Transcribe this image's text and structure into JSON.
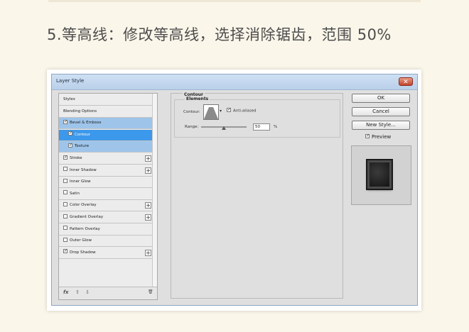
{
  "article": {
    "heading": "5.等高线：修改等高线，选择消除锯齿，范围 50%"
  },
  "dialog": {
    "title": "Layer Style",
    "close_symbol": "✕",
    "left_panel": {
      "items": [
        {
          "label": "Styles",
          "checked": null,
          "plus": false
        },
        {
          "label": "Blending Options",
          "checked": null,
          "plus": false
        },
        {
          "label": "Bevel & Emboss",
          "checked": true,
          "plus": false
        },
        {
          "label": "Contour",
          "checked": true,
          "plus": false
        },
        {
          "label": "Texture",
          "checked": true,
          "plus": false
        },
        {
          "label": "Stroke",
          "checked": true,
          "plus": true
        },
        {
          "label": "Inner Shadow",
          "checked": false,
          "plus": true
        },
        {
          "label": "Inner Glow",
          "checked": false,
          "plus": false
        },
        {
          "label": "Satin",
          "checked": false,
          "plus": false
        },
        {
          "label": "Color Overlay",
          "checked": false,
          "plus": true
        },
        {
          "label": "Gradient Overlay",
          "checked": false,
          "plus": true
        },
        {
          "label": "Pattern Overlay",
          "checked": false,
          "plus": false
        },
        {
          "label": "Outer Glow",
          "checked": false,
          "plus": false
        },
        {
          "label": "Drop Shadow",
          "checked": true,
          "plus": true
        }
      ],
      "fx_label": "fx",
      "up_symbol": "⇧",
      "down_symbol": "⇩",
      "trash_symbol": "🗑"
    },
    "middle_panel": {
      "section_title": "Contour",
      "group_title": "Elements",
      "contour_label": "Contour:",
      "anti_aliased_label": "Anti-aliased",
      "anti_aliased_checked": true,
      "range_label": "Range:",
      "range_value": "50",
      "range_unit": "%",
      "range_fraction": 0.5
    },
    "buttons": {
      "ok": "OK",
      "cancel": "Cancel",
      "new_style": "New Style..."
    },
    "preview": {
      "label": "Preview",
      "checked": true
    }
  }
}
